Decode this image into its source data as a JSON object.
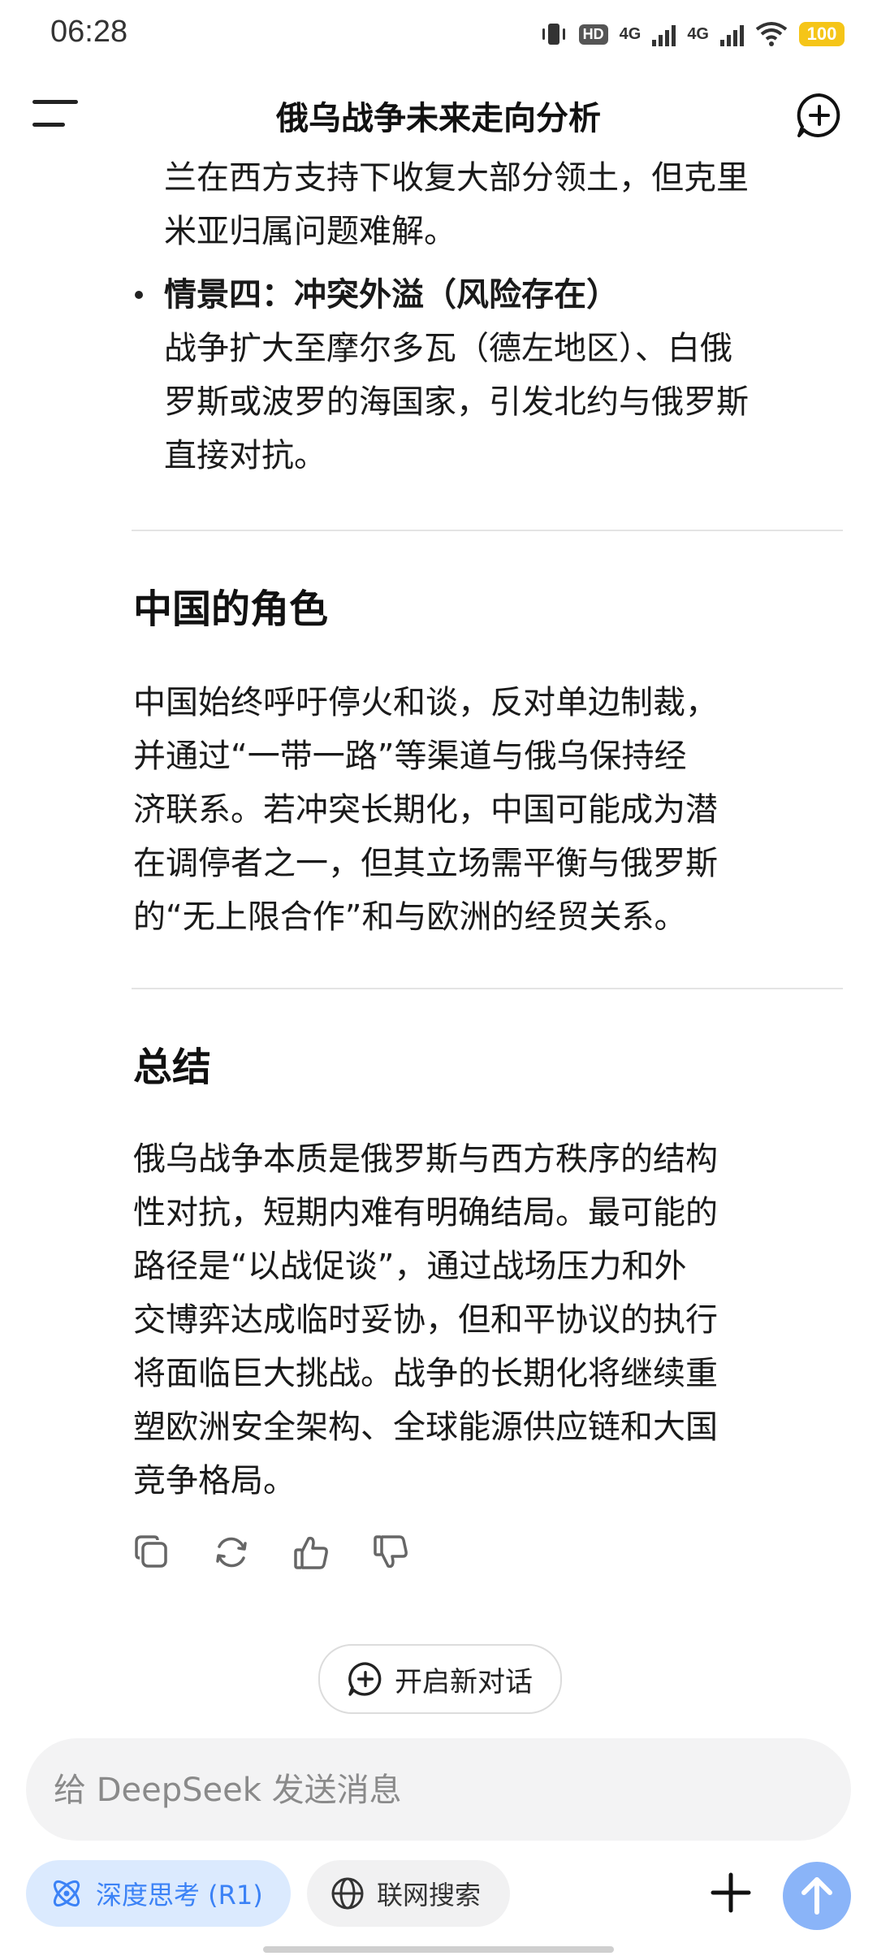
{
  "status": {
    "time": "06:28",
    "hd": "HD",
    "net1": "4G",
    "net2": "4G",
    "battery": "100"
  },
  "header": {
    "title": "俄乌战争未来走向分析"
  },
  "content": {
    "scenario3_tail": [
      "兰在西方支持下收复大部分领土，但克里",
      "米亚归属问题难解。"
    ],
    "scenario4_title": "情景四：冲突外溢（风险存在）",
    "scenario4_lines": [
      "战争扩大至摩尔多瓦（德左地区）、白俄",
      "罗斯或波罗的海国家，引发北约与俄罗斯",
      "直接对抗。"
    ],
    "section_china_title": "中国的角色",
    "section_china_lines": [
      "中国始终呼吁停火和谈，反对单边制裁，",
      "并通过“一带一路”等渠道与俄乌保持经",
      "济联系。若冲突长期化，中国可能成为潜",
      "在调停者之一，但其立场需平衡与俄罗斯",
      "的“无上限合作”和与欧洲的经贸关系。"
    ],
    "section_summary_title": "总结",
    "section_summary_lines": [
      "俄乌战争本质是俄罗斯与西方秩序的结构",
      "性对抗，短期内难有明确结局。最可能的",
      "路径是“以战促谈”，通过战场压力和外",
      "交博弈达成临时妥协，但和平协议的执行",
      "将面临巨大挑战。战争的长期化将继续重",
      "塑欧洲安全架构、全球能源供应链和大国",
      "竞争格局。"
    ]
  },
  "actions": {
    "icons": [
      "copy-icon",
      "regenerate-icon",
      "thumbs-up-icon",
      "thumbs-down-icon"
    ]
  },
  "new_conversation": {
    "label": "开启新对话"
  },
  "composer": {
    "placeholder": "给 DeepSeek 发送消息"
  },
  "toolbar": {
    "deep_think_label": "深度思考 (R1)",
    "web_search_label": "联网搜索"
  },
  "colors": {
    "accent": "#3b82f6",
    "accent_bg": "#dbeafe",
    "send_button": "#8ab4f8",
    "battery": "#f5c518"
  }
}
